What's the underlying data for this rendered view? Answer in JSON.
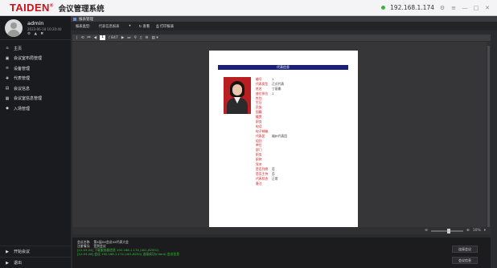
{
  "titlebar": {
    "brand": "TAIDEN",
    "brand_mark": "®",
    "title": "会议管理系统",
    "ip": "192.168.1.174",
    "controls": [
      "⚙",
      "≡",
      "—",
      "□",
      "✕"
    ]
  },
  "user": {
    "name": "admin",
    "datetime": "2023-06-18 10:20:40",
    "icons": "⚙ ▲ ✖"
  },
  "nav": [
    {
      "icon": "⌂",
      "label": "主页"
    },
    {
      "icon": "▣",
      "label": "会议室布局管理"
    },
    {
      "icon": "≋",
      "label": "设备管理"
    },
    {
      "icon": "✚",
      "label": "代表管理"
    },
    {
      "icon": "▤",
      "label": "会议信息"
    },
    {
      "icon": "▦",
      "label": "会议室信息管理"
    },
    {
      "icon": "◆",
      "label": "入场管理"
    }
  ],
  "sidebar_bottom": [
    {
      "icon": "▶",
      "label": "开始会议"
    },
    {
      "icon": "▶",
      "label": "退出"
    }
  ],
  "main": {
    "tab_label": "报表管理",
    "toolbar": {
      "report_type_label": "报表类型:",
      "report_type_value": "代表信息报表",
      "view_button": "↻ 查看",
      "print_button": "⎙ 打印报表"
    },
    "viewer": {
      "page_current": "1",
      "page_total": "/ 847",
      "tools": [
        "|",
        "⟲",
        "⏮",
        "◀"
      ],
      "tools_right": [
        "▶",
        "⏭",
        "⚲",
        "▯",
        "⚙",
        "▤ ▾"
      ],
      "zoom_label": "10%",
      "zoom_tools": [
        "⊖",
        "⊕",
        "▾"
      ]
    },
    "document": {
      "header": "代表信息",
      "fields": [
        {
          "label": "编号",
          "value": "1"
        },
        {
          "label": "代表类型",
          "value": "正式代表"
        },
        {
          "label": "姓名",
          "value": "丁丽娜"
        },
        {
          "label": "座位排位",
          "value": "1"
        },
        {
          "label": "性别",
          "value": ""
        },
        {
          "label": "生日",
          "value": ""
        },
        {
          "label": "民族",
          "value": ""
        },
        {
          "label": "国籍",
          "value": ""
        },
        {
          "label": "籍贯",
          "value": ""
        },
        {
          "label": "职务",
          "value": ""
        },
        {
          "label": "电话",
          "value": ""
        },
        {
          "label": "电子邮箱",
          "value": ""
        },
        {
          "label": "代表团",
          "value": "福州代表团"
        },
        {
          "label": "组别",
          "value": ""
        },
        {
          "label": "单位",
          "value": ""
        },
        {
          "label": "部门",
          "value": ""
        },
        {
          "label": "职务",
          "value": ""
        },
        {
          "label": "职称",
          "value": ""
        },
        {
          "label": "党派",
          "value": ""
        },
        {
          "label": "是否列席",
          "value": "否"
        },
        {
          "label": "是否主持",
          "value": "否"
        },
        {
          "label": "代表状态",
          "value": "正常"
        },
        {
          "label": "备注",
          "value": ""
        }
      ]
    },
    "status": {
      "line1_key": "会议名称:",
      "line1_val": "第X届XX会议XX代表大会",
      "line2_key": "注册情况:",
      "line2_val": "签到会议",
      "log1": "[12:03:24] 下载服务器信息 192.168.1.174 (401-82551)",
      "log2": "[12:03:28] 会议 192.168.1.174 (401-8250) 连接成功(Client) 会议信息",
      "btn1": "连接会议",
      "btn2": "会议信息"
    }
  }
}
